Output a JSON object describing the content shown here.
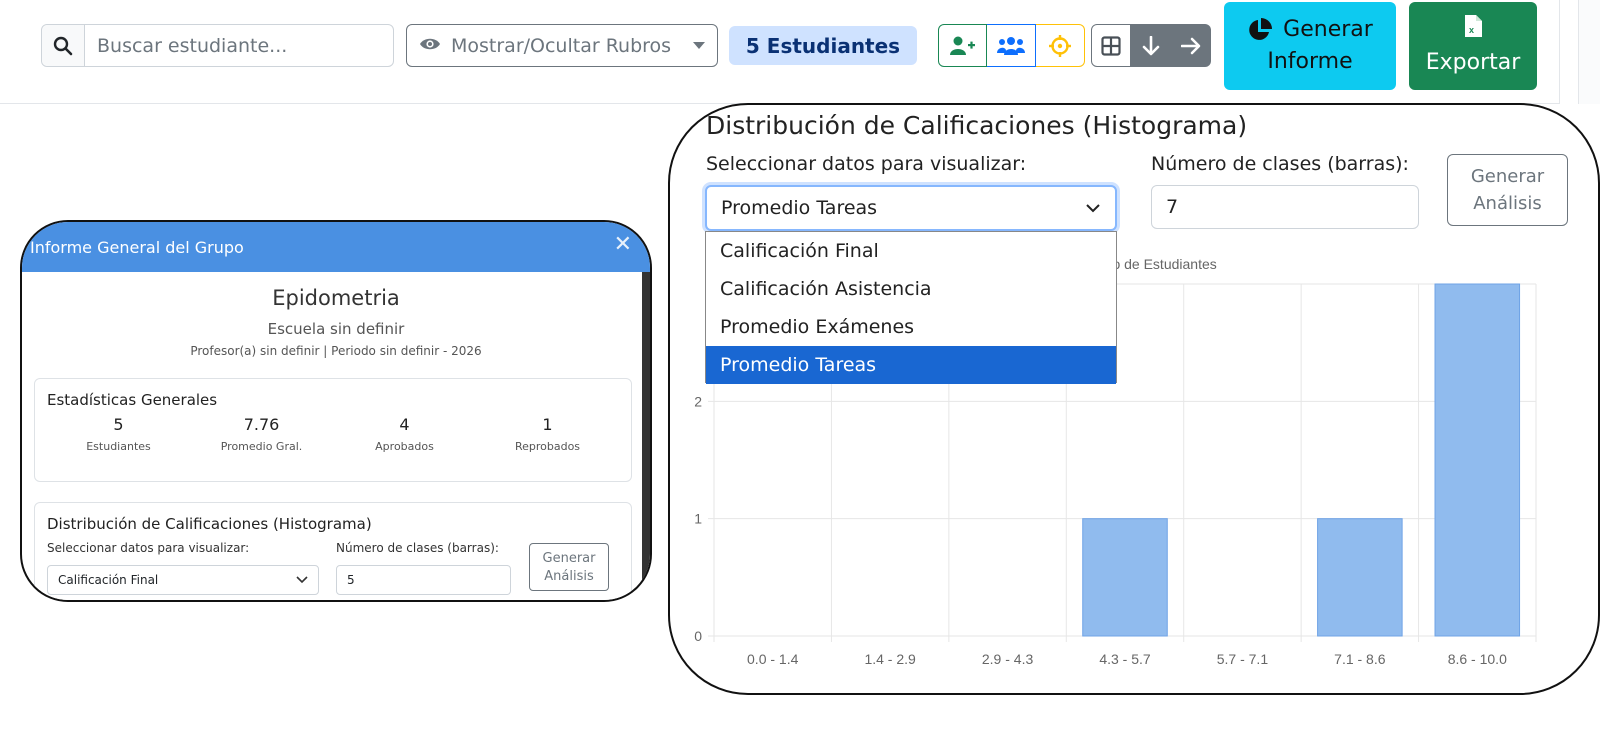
{
  "toolbar": {
    "search_placeholder": "Buscar estudiante...",
    "toggle_label": "Mostrar/Ocultar Rubros",
    "student_count": "5 Estudiantes",
    "generate_report": [
      "Generar",
      "Informe"
    ],
    "export_label": "Exportar"
  },
  "group_report": {
    "header": "Informe General del Grupo",
    "course": "Epidometria",
    "school": "Escuela sin definir",
    "teacher_period": "Profesor(a) sin definir | Periodo sin definir - 2026",
    "stats_title": "Estadísticas Generales",
    "stats": [
      {
        "value": "5",
        "label": "Estudiantes"
      },
      {
        "value": "7.76",
        "label": "Promedio Gral."
      },
      {
        "value": "4",
        "label": "Aprobados"
      },
      {
        "value": "1",
        "label": "Reprobados"
      }
    ],
    "hist_title": "Distribución de Calificaciones (Histograma)",
    "select_label": "Seleccionar datos para visualizar:",
    "bins_label": "Número de clases (barras):",
    "select_value": "Calificación Final",
    "bins_value": "5",
    "analyze_button": [
      "Generar",
      "Análisis"
    ]
  },
  "histogram_panel": {
    "title": "Distribución de Calificaciones (Histograma)",
    "select_label": "Seleccionar datos para visualizar:",
    "bins_label": "Número de clases (barras):",
    "select_value": "Promedio Tareas",
    "bins_value": "7",
    "analyze_button": [
      "Generar",
      "Análisis"
    ],
    "options": [
      "Calificación Final",
      "Calificación Asistencia",
      "Promedio Exámenes",
      "Promedio Tareas"
    ],
    "selected_index": 3
  },
  "chart_data": {
    "type": "bar",
    "categories": [
      "0.0 - 1.4",
      "1.4 - 2.9",
      "2.9 - 4.3",
      "4.3 - 5.7",
      "5.7 - 7.1",
      "7.1 - 8.6",
      "8.6 - 10.0"
    ],
    "values": [
      0,
      0,
      0,
      1,
      0,
      1,
      3
    ],
    "ylabel": "ero de Estudiantes",
    "ylim": [
      0,
      3
    ],
    "yticks": [
      0,
      1,
      2
    ],
    "grid": true,
    "bar_color": "#90bbee"
  },
  "colors": {
    "accent_blue": "#4a90e2",
    "info": "#0dcaf0",
    "success": "#198754",
    "badge_bg": "#cfe2ff",
    "selected_option": "#1967d2"
  }
}
